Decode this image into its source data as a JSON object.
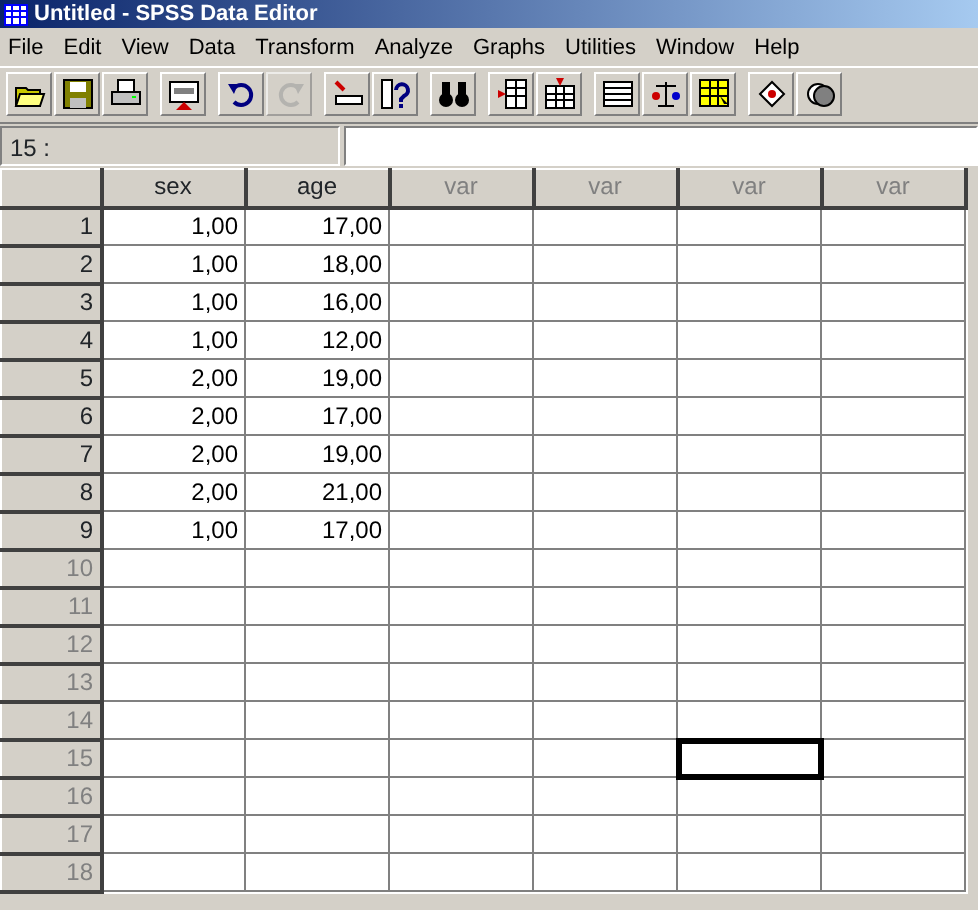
{
  "window": {
    "title": "Untitled - SPSS Data Editor"
  },
  "menu": [
    "File",
    "Edit",
    "View",
    "Data",
    "Transform",
    "Analyze",
    "Graphs",
    "Utilities",
    "Window",
    "Help"
  ],
  "toolbar": [
    [
      {
        "kind": "open",
        "disabled": false
      },
      {
        "kind": "save",
        "disabled": false
      },
      {
        "kind": "print",
        "disabled": false
      }
    ],
    [
      {
        "kind": "recall",
        "disabled": false
      }
    ],
    [
      {
        "kind": "undo",
        "disabled": false
      },
      {
        "kind": "redo",
        "disabled": true
      }
    ],
    [
      {
        "kind": "goto",
        "disabled": false
      },
      {
        "kind": "variables",
        "disabled": false
      }
    ],
    [
      {
        "kind": "find",
        "disabled": false
      }
    ],
    [
      {
        "kind": "insert-case",
        "disabled": false
      },
      {
        "kind": "insert-variable",
        "disabled": false
      }
    ],
    [
      {
        "kind": "split",
        "disabled": false
      },
      {
        "kind": "weight",
        "disabled": false
      },
      {
        "kind": "select",
        "disabled": false
      }
    ],
    [
      {
        "kind": "labels",
        "disabled": false
      },
      {
        "kind": "sets",
        "disabled": false
      }
    ]
  ],
  "cell_editor": {
    "reference": "15 :"
  },
  "columns": [
    {
      "label": "sex",
      "defined": true
    },
    {
      "label": "age",
      "defined": true
    },
    {
      "label": "var",
      "defined": false
    },
    {
      "label": "var",
      "defined": false
    },
    {
      "label": "var",
      "defined": false
    },
    {
      "label": "var",
      "defined": false
    }
  ],
  "rows": [
    {
      "number": "1",
      "empty": false,
      "cells": [
        {
          "value": "1,00",
          "selected": false
        },
        {
          "value": "17,00",
          "selected": false
        },
        {
          "selected": false
        },
        {
          "selected": false
        },
        {
          "selected": false
        },
        {
          "selected": false
        }
      ]
    },
    {
      "number": "2",
      "empty": false,
      "cells": [
        {
          "value": "1,00",
          "selected": false
        },
        {
          "value": "18,00",
          "selected": false
        },
        {
          "selected": false
        },
        {
          "selected": false
        },
        {
          "selected": false
        },
        {
          "selected": false
        }
      ]
    },
    {
      "number": "3",
      "empty": false,
      "cells": [
        {
          "value": "1,00",
          "selected": false
        },
        {
          "value": "16,00",
          "selected": false
        },
        {
          "selected": false
        },
        {
          "selected": false
        },
        {
          "selected": false
        },
        {
          "selected": false
        }
      ]
    },
    {
      "number": "4",
      "empty": false,
      "cells": [
        {
          "value": "1,00",
          "selected": false
        },
        {
          "value": "12,00",
          "selected": false
        },
        {
          "selected": false
        },
        {
          "selected": false
        },
        {
          "selected": false
        },
        {
          "selected": false
        }
      ]
    },
    {
      "number": "5",
      "empty": false,
      "cells": [
        {
          "value": "2,00",
          "selected": false
        },
        {
          "value": "19,00",
          "selected": false
        },
        {
          "selected": false
        },
        {
          "selected": false
        },
        {
          "selected": false
        },
        {
          "selected": false
        }
      ]
    },
    {
      "number": "6",
      "empty": false,
      "cells": [
        {
          "value": "2,00",
          "selected": false
        },
        {
          "value": "17,00",
          "selected": false
        },
        {
          "selected": false
        },
        {
          "selected": false
        },
        {
          "selected": false
        },
        {
          "selected": false
        }
      ]
    },
    {
      "number": "7",
      "empty": false,
      "cells": [
        {
          "value": "2,00",
          "selected": false
        },
        {
          "value": "19,00",
          "selected": false
        },
        {
          "selected": false
        },
        {
          "selected": false
        },
        {
          "selected": false
        },
        {
          "selected": false
        }
      ]
    },
    {
      "number": "8",
      "empty": false,
      "cells": [
        {
          "value": "2,00",
          "selected": false
        },
        {
          "value": "21,00",
          "selected": false
        },
        {
          "selected": false
        },
        {
          "selected": false
        },
        {
          "selected": false
        },
        {
          "selected": false
        }
      ]
    },
    {
      "number": "9",
      "empty": false,
      "cells": [
        {
          "value": "1,00",
          "selected": false
        },
        {
          "value": "17,00",
          "selected": false
        },
        {
          "selected": false
        },
        {
          "selected": false
        },
        {
          "selected": false
        },
        {
          "selected": false
        }
      ]
    },
    {
      "number": "10",
      "empty": true,
      "cells": [
        {
          "selected": false
        },
        {
          "selected": false
        },
        {
          "selected": false
        },
        {
          "selected": false
        },
        {
          "selected": false
        },
        {
          "selected": false
        }
      ]
    },
    {
      "number": "11",
      "empty": true,
      "cells": [
        {
          "selected": false
        },
        {
          "selected": false
        },
        {
          "selected": false
        },
        {
          "selected": false
        },
        {
          "selected": false
        },
        {
          "selected": false
        }
      ]
    },
    {
      "number": "12",
      "empty": true,
      "cells": [
        {
          "selected": false
        },
        {
          "selected": false
        },
        {
          "selected": false
        },
        {
          "selected": false
        },
        {
          "selected": false
        },
        {
          "selected": false
        }
      ]
    },
    {
      "number": "13",
      "empty": true,
      "cells": [
        {
          "selected": false
        },
        {
          "selected": false
        },
        {
          "selected": false
        },
        {
          "selected": false
        },
        {
          "selected": false
        },
        {
          "selected": false
        }
      ]
    },
    {
      "number": "14",
      "empty": true,
      "cells": [
        {
          "selected": false
        },
        {
          "selected": false
        },
        {
          "selected": false
        },
        {
          "selected": false
        },
        {
          "selected": false
        },
        {
          "selected": false
        }
      ]
    },
    {
      "number": "15",
      "empty": true,
      "cells": [
        {
          "selected": false
        },
        {
          "selected": false
        },
        {
          "selected": false
        },
        {
          "selected": false
        },
        {
          "selected": true
        },
        {
          "selected": false
        }
      ]
    },
    {
      "number": "16",
      "empty": true,
      "cells": [
        {
          "selected": false
        },
        {
          "selected": false
        },
        {
          "selected": false
        },
        {
          "selected": false
        },
        {
          "selected": false
        },
        {
          "selected": false
        }
      ]
    },
    {
      "number": "17",
      "empty": true,
      "cells": [
        {
          "selected": false
        },
        {
          "selected": false
        },
        {
          "selected": false
        },
        {
          "selected": false
        },
        {
          "selected": false
        },
        {
          "selected": false
        }
      ]
    },
    {
      "number": "18",
      "empty": true,
      "cells": [
        {
          "selected": false
        },
        {
          "selected": false
        },
        {
          "selected": false
        },
        {
          "selected": false
        },
        {
          "selected": false
        },
        {
          "selected": false
        }
      ]
    }
  ]
}
